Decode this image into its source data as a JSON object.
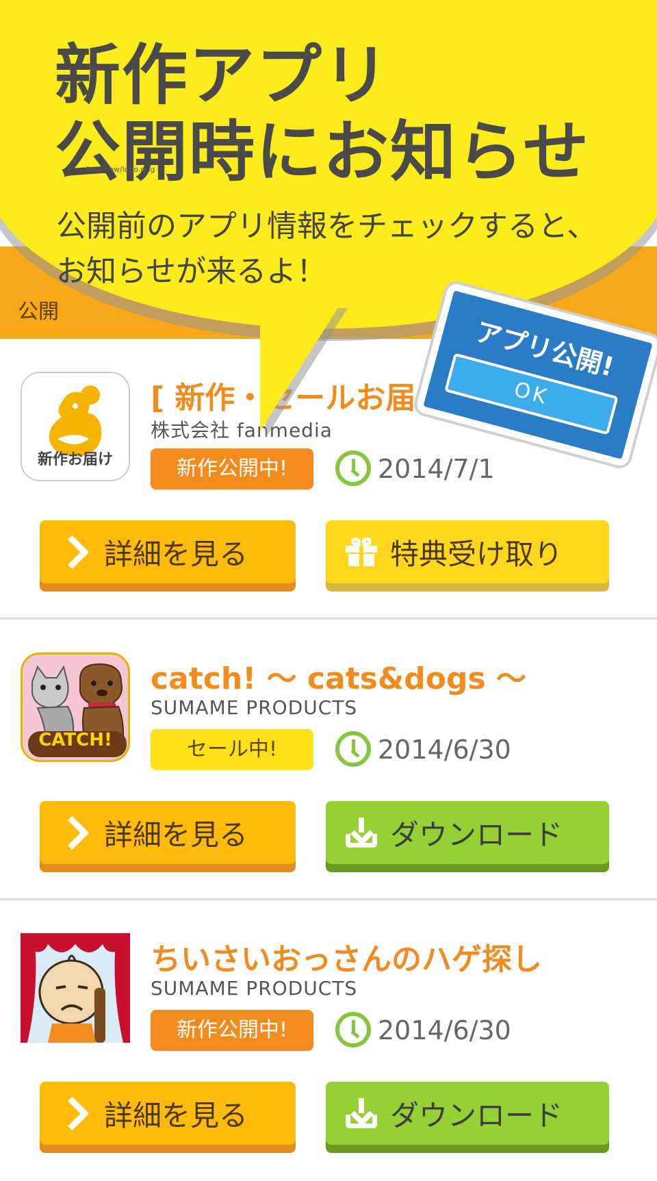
{
  "header": {
    "label": "公開"
  },
  "popup": {
    "title_line1": "新作アプリ",
    "title_line2": "公開時にお知らせ",
    "logo_alt": "/img/new/logo.png",
    "text_line1": "公開前のアプリ情報をチェックすると、",
    "text_line2": "お知らせが来るよ！",
    "sign_title": "アプリ公開!",
    "sign_ok": "OK"
  },
  "items": [
    {
      "title": "[ 新作・セールお届け",
      "developer": "株式会社 fanmedia",
      "badge": "新作公開中!",
      "badge_type": "new",
      "date": "2014/7/1",
      "detail_label": "詳細を見る",
      "action_label": "特典受け取り",
      "action_icon": "gift-icon",
      "icon_text": "新作お届け"
    },
    {
      "title": "catch! 〜 cats&dogs 〜",
      "developer": "SUMAME PRODUCTS",
      "badge": "セール中!",
      "badge_type": "sale",
      "date": "2014/6/30",
      "detail_label": "詳細を見る",
      "action_label": "ダウンロード",
      "action_icon": "download-icon",
      "icon_text": "CATCH!"
    },
    {
      "title": "ちいさいおっさんのハゲ探し",
      "developer": "SUMAME PRODUCTS",
      "badge": "新作公開中!",
      "badge_type": "new",
      "date": "2014/6/30",
      "detail_label": "詳細を見る",
      "action_label": "ダウンロード",
      "action_icon": "download-icon"
    }
  ],
  "colors": {
    "accent_orange": "#f08c1e",
    "header_orange": "#f9a818",
    "popup_yellow": "#fdec1b",
    "sign_blue": "#2a7cc6",
    "download_green": "#95d035",
    "date_green": "#86c63f"
  }
}
